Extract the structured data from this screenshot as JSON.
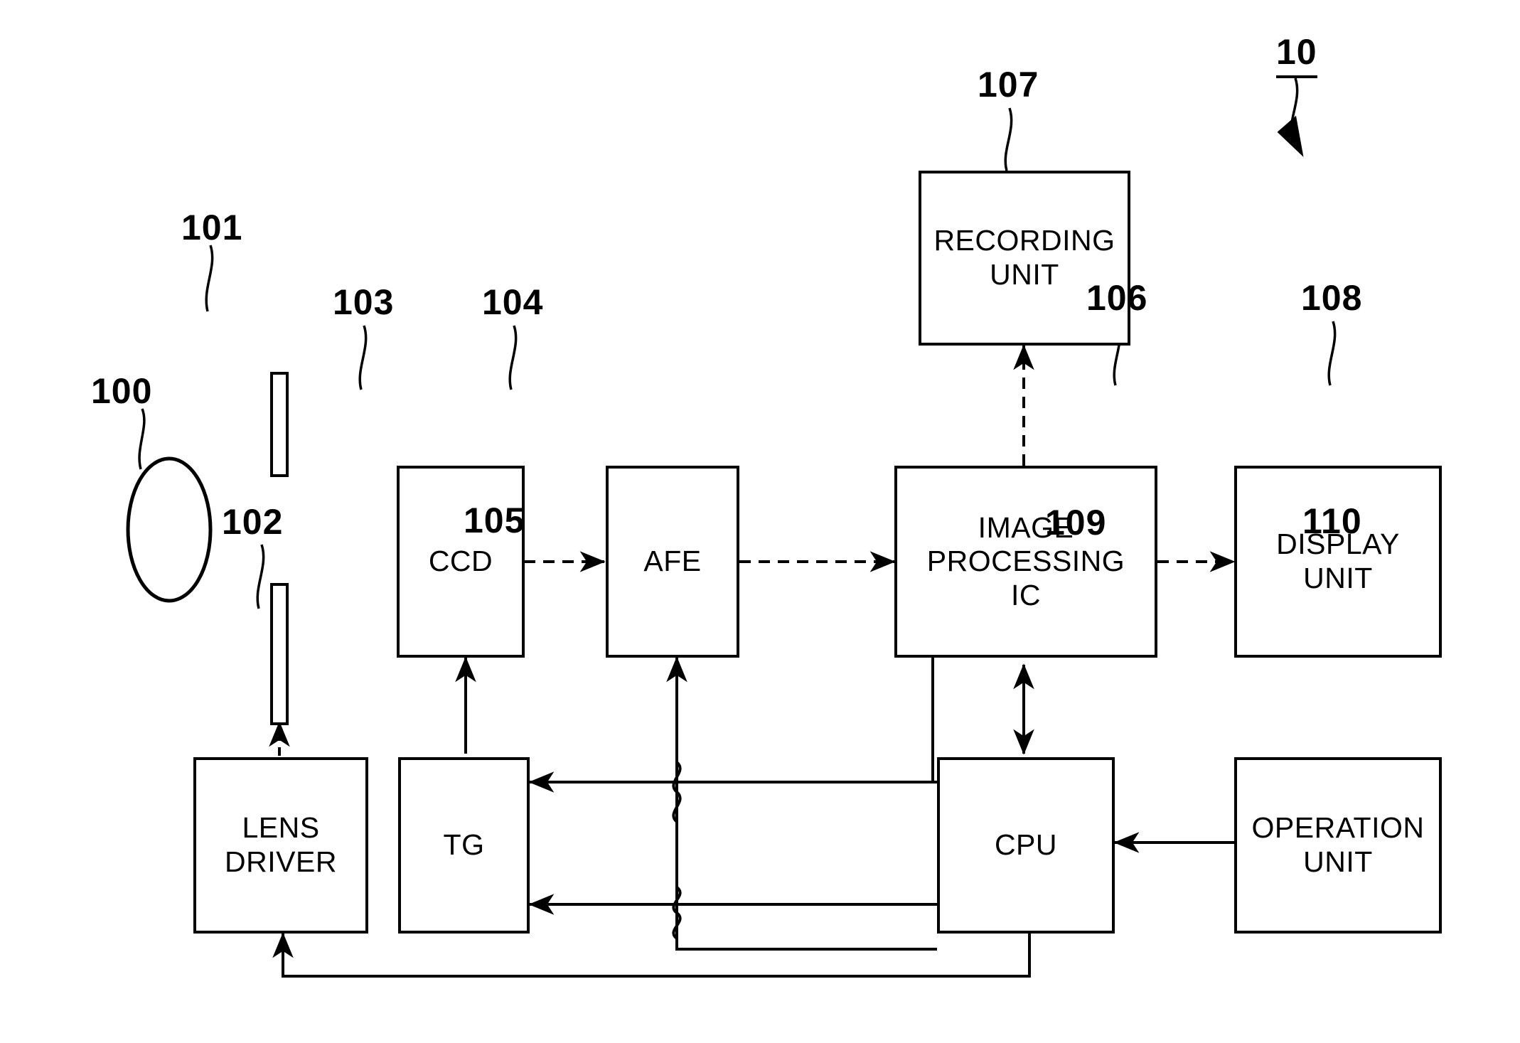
{
  "figure": {
    "overall_ref": "10",
    "blocks": [
      {
        "id": "lens",
        "ref": "100",
        "label": ""
      },
      {
        "id": "shutter",
        "ref": "101",
        "label": ""
      },
      {
        "id": "lens_driver",
        "ref": "102",
        "label": "LENS\nDRIVER"
      },
      {
        "id": "ccd",
        "ref": "103",
        "label": "CCD"
      },
      {
        "id": "afe",
        "ref": "104",
        "label": "AFE"
      },
      {
        "id": "tg",
        "ref": "105",
        "label": "TG"
      },
      {
        "id": "ipic",
        "ref": "106",
        "label": "IMAGE\nPROCESSING\nIC"
      },
      {
        "id": "recording",
        "ref": "107",
        "label": "RECORDING\nUNIT"
      },
      {
        "id": "display",
        "ref": "108",
        "label": "DISPLAY\nUNIT"
      },
      {
        "id": "cpu",
        "ref": "109",
        "label": "CPU"
      },
      {
        "id": "operation",
        "ref": "110",
        "label": "OPERATION\nUNIT"
      }
    ],
    "colors": {
      "line": "#000000",
      "background": "#ffffff",
      "text": "#000000"
    }
  }
}
